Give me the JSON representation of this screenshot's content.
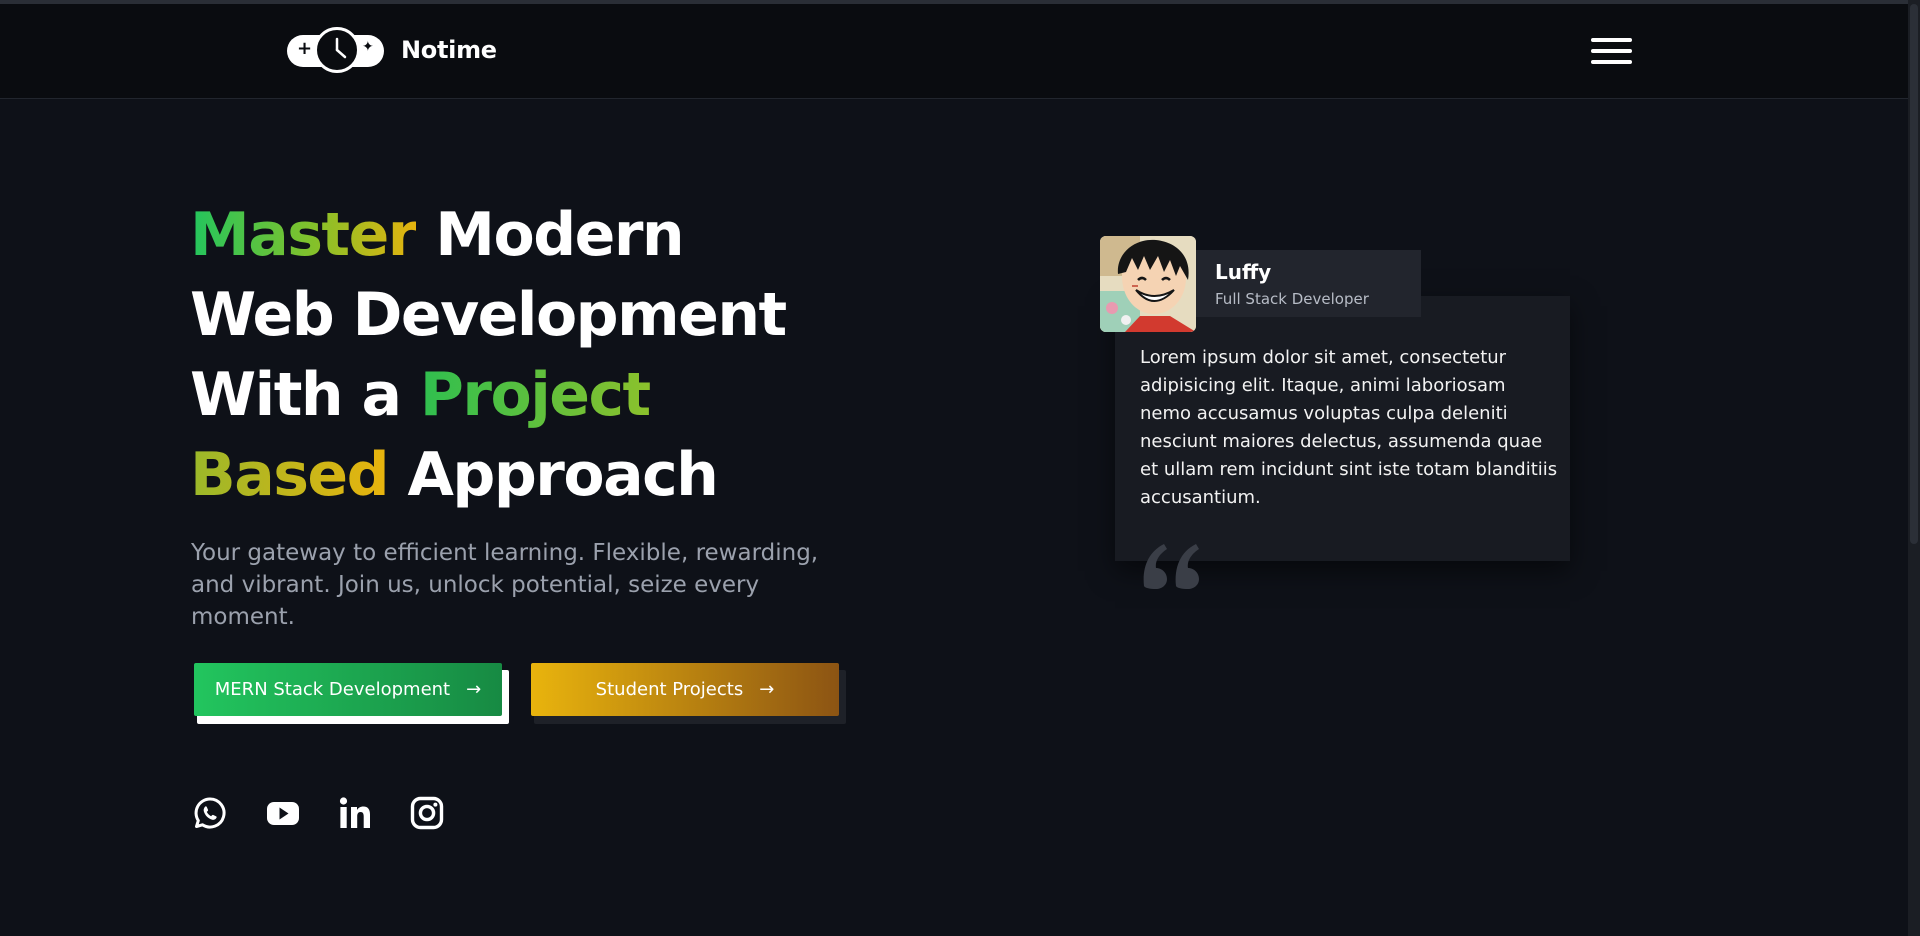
{
  "brand": {
    "name": "Notime"
  },
  "hero": {
    "title": {
      "line1_accent": "Master",
      "line1_rest": " Modern",
      "line2": "Web Development",
      "line3_start": "With a ",
      "line3_accent": "Project",
      "line4_accent": "Based",
      "line4_rest": " Approach"
    },
    "subtitle": "Your gateway to efficient learning. Flexible, rewarding, and vibrant. Join us, unlock potential, seize every moment.",
    "buttons": [
      {
        "label": "MERN Stack Development",
        "arrow": "→"
      },
      {
        "label": "Student Projects",
        "arrow": "→"
      }
    ]
  },
  "social": [
    {
      "icon": "whatsapp-icon"
    },
    {
      "icon": "youtube-icon"
    },
    {
      "icon": "linkedin-icon"
    },
    {
      "icon": "instagram-icon"
    }
  ],
  "testimonial": {
    "name": "Luffy",
    "role": "Full Stack Developer",
    "text": "Lorem ipsum dolor sit amet, consectetur adipisicing elit. Itaque, animi laboriosam nemo accusamus voluptas culpa deleniti nesciunt maiores delectus, assumenda quae et ullam rem incidunt sint iste totam blanditiis accusantium."
  },
  "colors": {
    "background": "#0e1118",
    "navbar": "#0a0c10",
    "green": "#22c55e",
    "gold": "#e9b40d",
    "muted_text": "#9ba1ad",
    "card": "#181b22"
  }
}
